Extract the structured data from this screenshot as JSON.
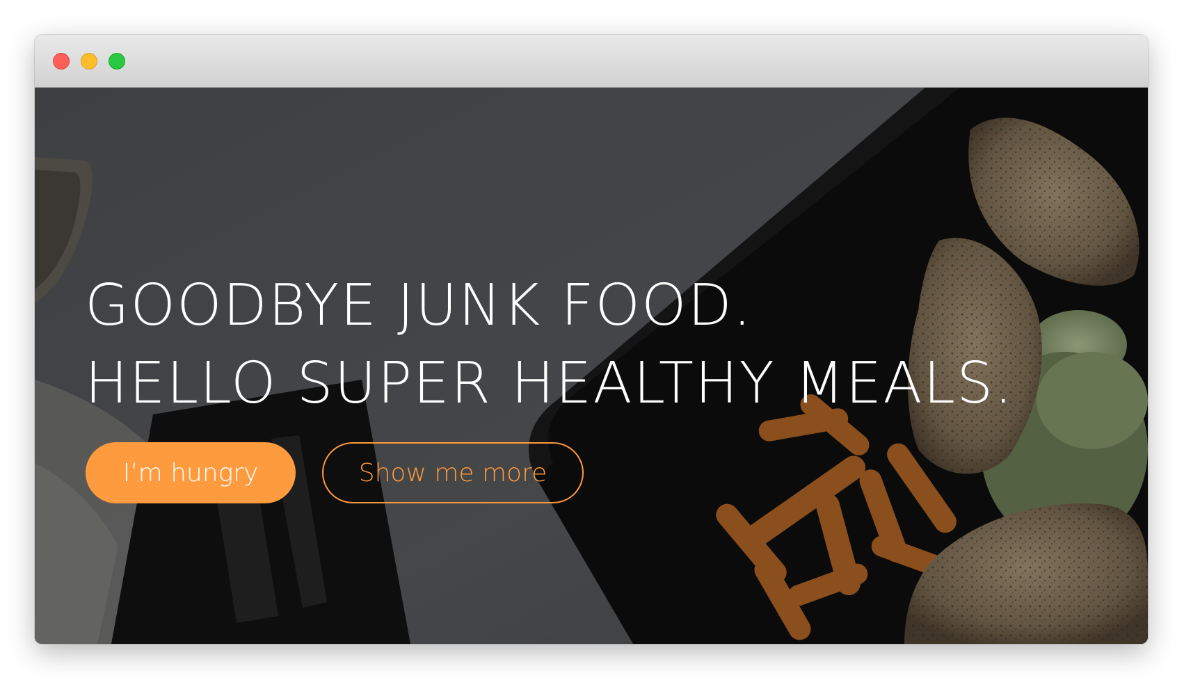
{
  "window": {
    "controls": [
      "close",
      "minimize",
      "zoom"
    ]
  },
  "hero": {
    "headline_line1": "GOODBYE JUNK FOOD.",
    "headline_line2": "HELLO SUPER HEALTHY MEALS.",
    "primary_button": "I’m hungry",
    "secondary_button": "Show me more"
  },
  "colors": {
    "accent": "#ff9b3f",
    "text": "#ffffff",
    "close": "#fe5f57",
    "minimize": "#ffbd2e",
    "zoom": "#28c840"
  }
}
